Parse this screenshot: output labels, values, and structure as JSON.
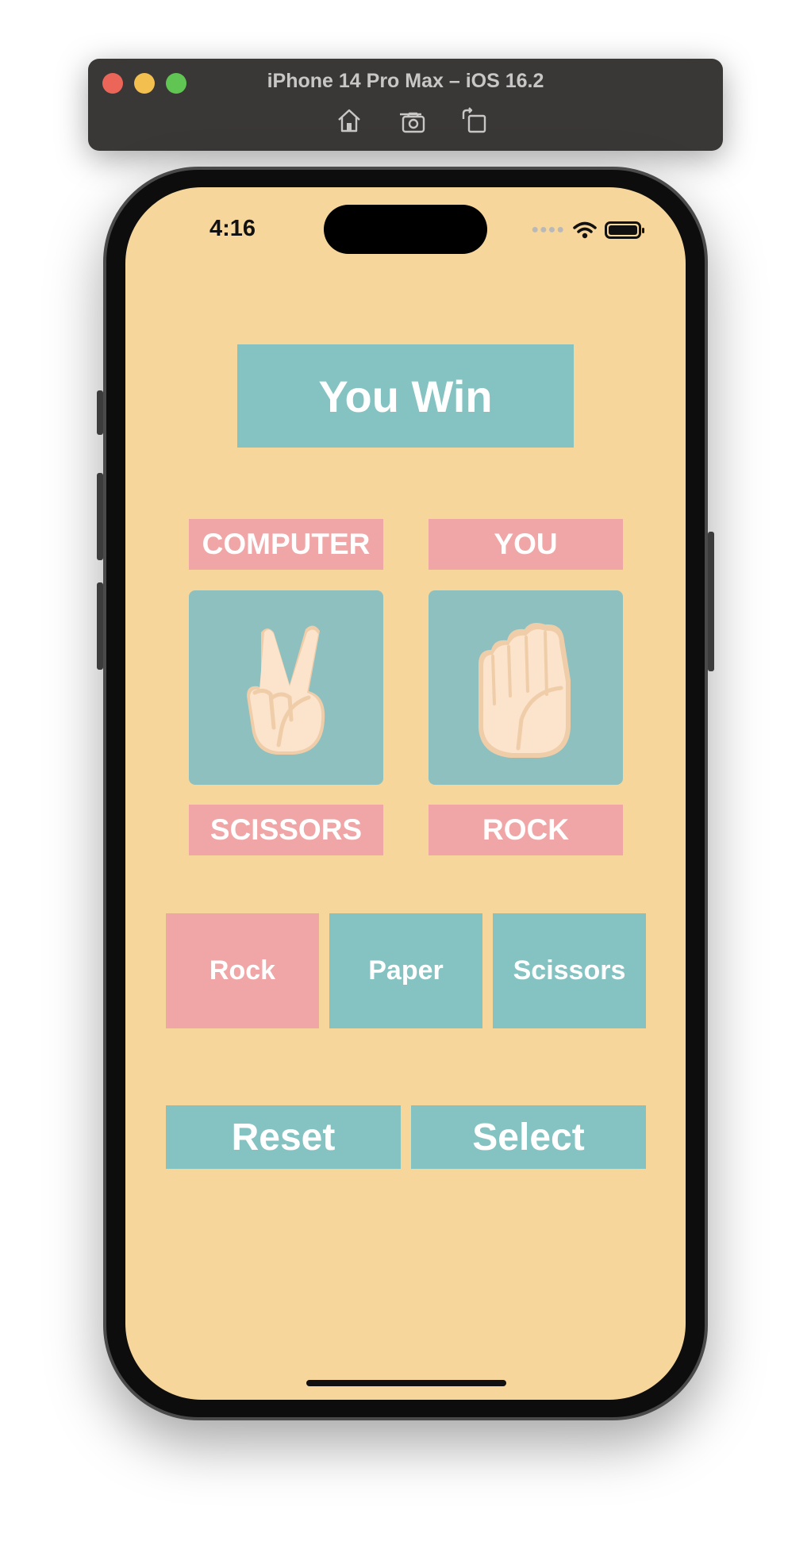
{
  "simulator": {
    "title": "iPhone 14 Pro Max – iOS 16.2",
    "tools": [
      "home-icon",
      "screenshot-icon",
      "rotate-icon"
    ]
  },
  "status_bar": {
    "time": "4:16"
  },
  "game": {
    "result": "You Win",
    "computer_label": "COMPUTER",
    "player_label": "YOU",
    "computer_choice": "SCISSORS",
    "player_choice": "ROCK",
    "computer_hand_icon": "victory-hand-icon",
    "player_hand_icon": "raised-fist-icon"
  },
  "choices": [
    {
      "label": "Rock",
      "selected": true
    },
    {
      "label": "Paper",
      "selected": false
    },
    {
      "label": "Scissors",
      "selected": false
    }
  ],
  "actions": {
    "reset_label": "Reset",
    "select_label": "Select"
  },
  "colors": {
    "background": "#f6d69b",
    "teal": "#84c3c1",
    "pink": "#f0a6a6",
    "card": "#8ec0bf",
    "text": "#ffffff"
  }
}
